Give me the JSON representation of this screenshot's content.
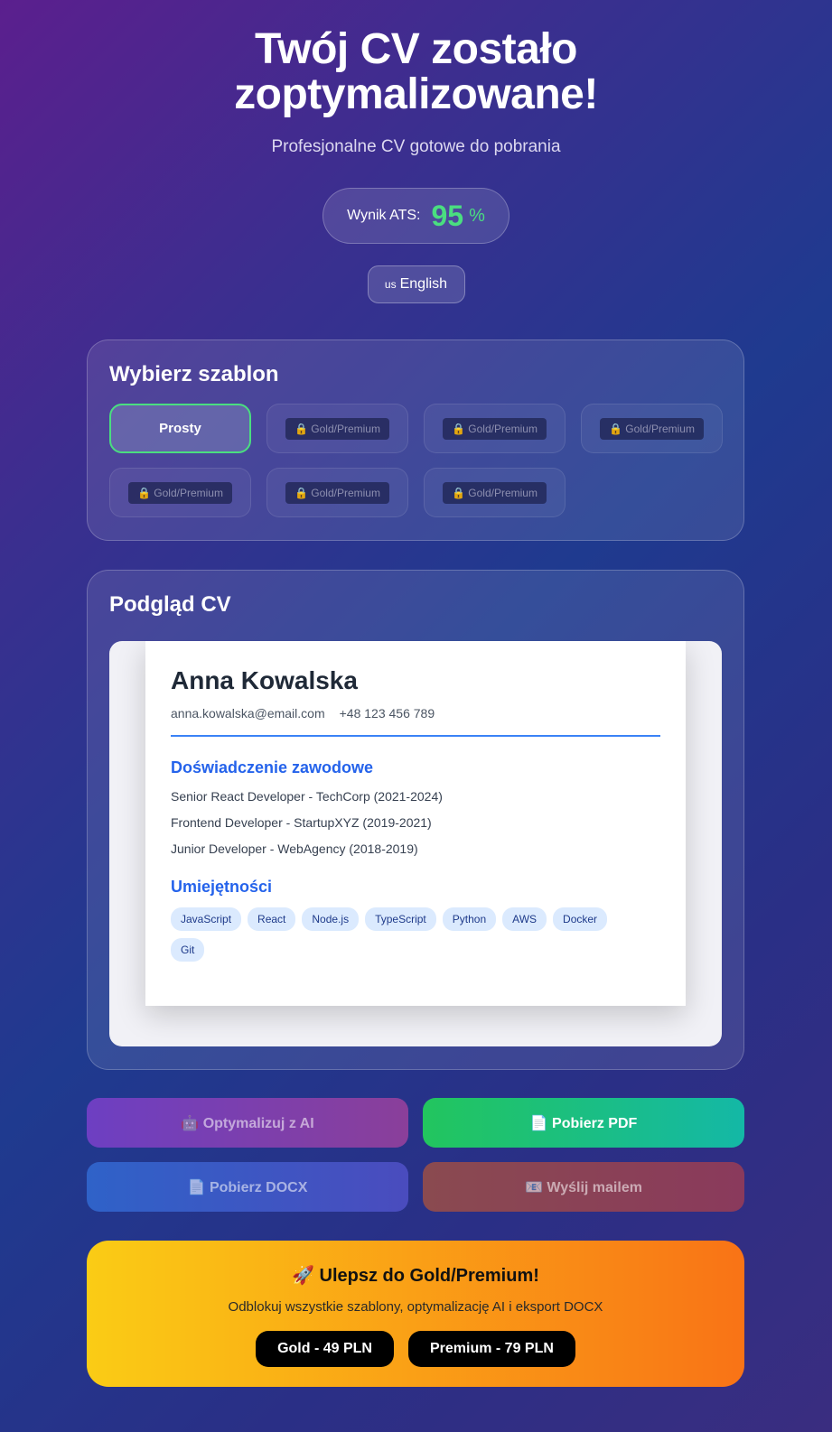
{
  "header": {
    "title": "Twój CV zostało zoptymalizowane!",
    "subtitle": "Profesjonalne CV gotowe do pobrania",
    "ats_label": "Wynik ATS:",
    "ats_value": "95",
    "ats_unit": "%",
    "language": {
      "flag": "us",
      "label": "English"
    }
  },
  "templates": {
    "heading": "Wybierz szablon",
    "active": "Prosty",
    "locked_label": "🔒 Gold/Premium",
    "locked_count": 6
  },
  "preview": {
    "heading": "Podgląd CV",
    "name": "Anna Kowalska",
    "email": "anna.kowalska@email.com",
    "phone": "+48 123 456 789",
    "experience_heading": "Doświadczenie zawodowe",
    "experience": [
      "Senior React Developer - TechCorp (2021-2024)",
      "Frontend Developer - StartupXYZ (2019-2021)",
      "Junior Developer - WebAgency (2018-2019)"
    ],
    "skills_heading": "Umiejętności",
    "skills": [
      "JavaScript",
      "React",
      "Node.js",
      "TypeScript",
      "Python",
      "AWS",
      "Docker",
      "Git"
    ]
  },
  "actions": {
    "optimize": "🤖 Optymalizuj z AI",
    "pdf": "📄 Pobierz PDF",
    "docx": "📄 Pobierz DOCX",
    "email": "📧 Wyślij mailem"
  },
  "upsell": {
    "title": "🚀 Ulepsz do Gold/Premium!",
    "description": "Odblokuj wszystkie szablony, optymalizację AI i eksport DOCX",
    "gold": "Gold - 49 PLN",
    "premium": "Premium - 79 PLN"
  },
  "colors": {
    "accent_green": "#4ade80",
    "cv_blue": "#2563eb",
    "upsell_from": "#facc15",
    "upsell_to": "#f97316"
  }
}
